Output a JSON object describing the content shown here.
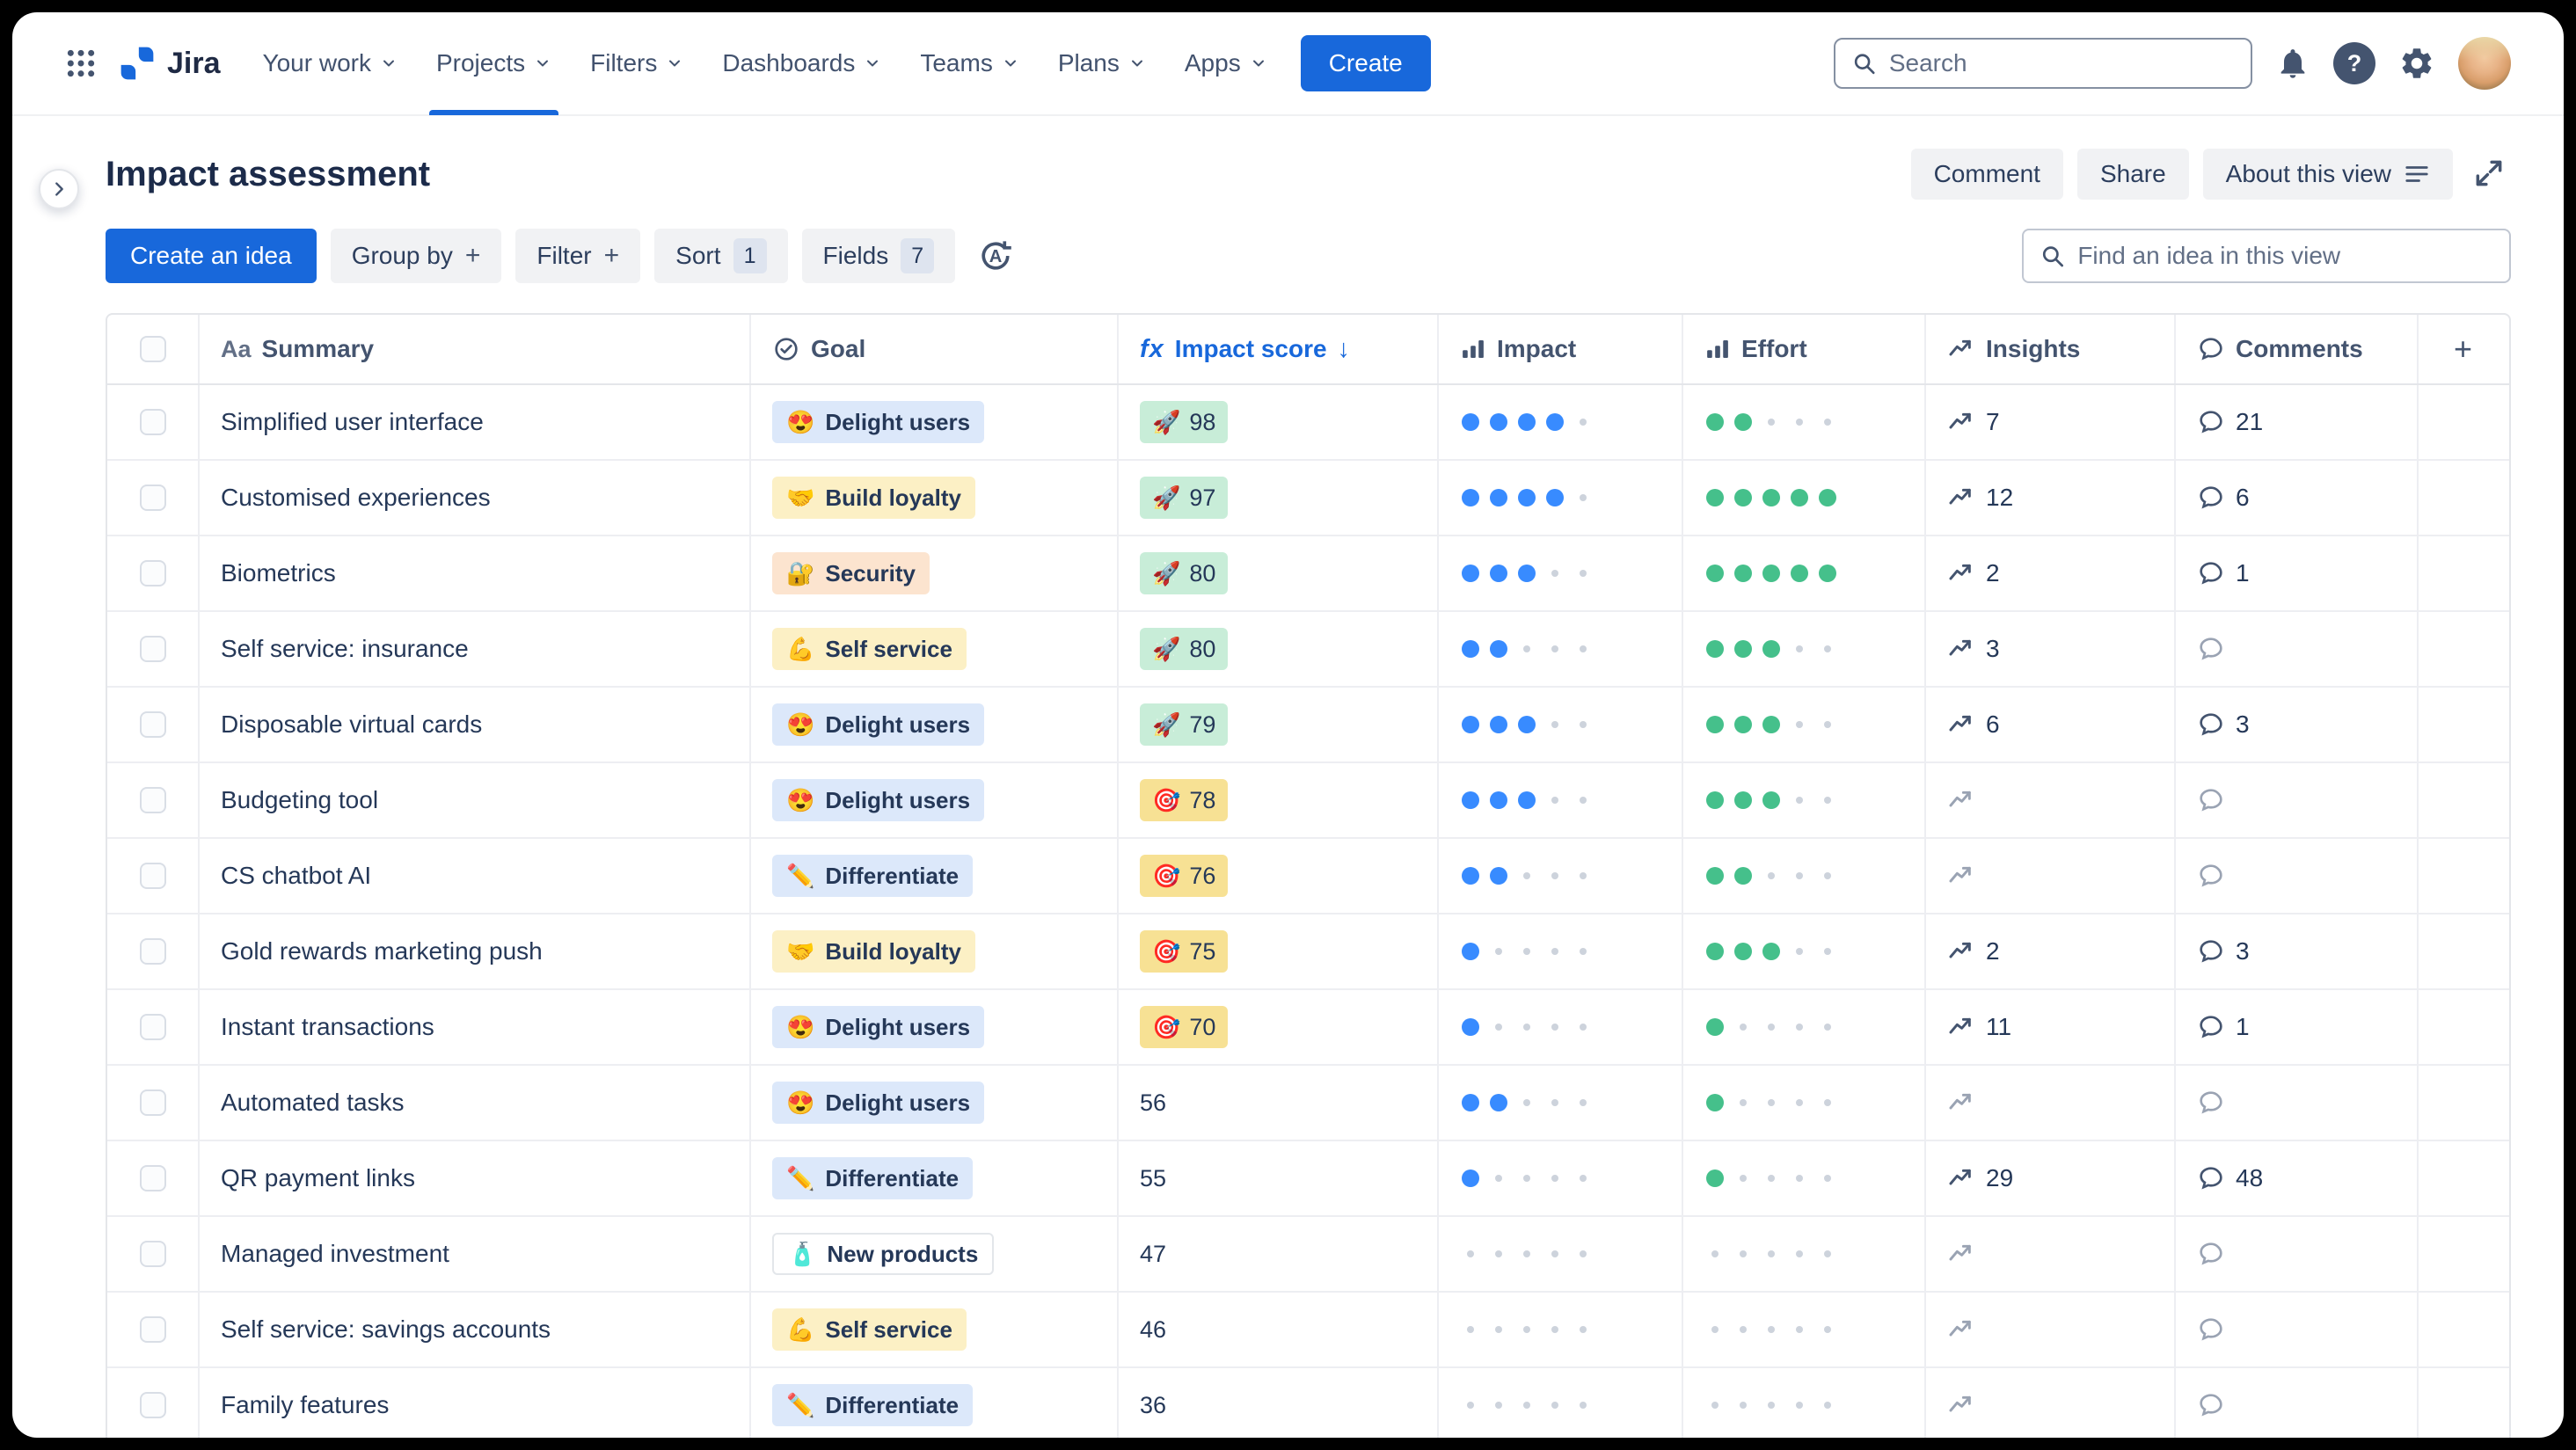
{
  "nav": {
    "logo_text": "Jira",
    "items": [
      {
        "id": "your-work",
        "label": "Your work"
      },
      {
        "id": "projects",
        "label": "Projects",
        "active": true
      },
      {
        "id": "filters",
        "label": "Filters"
      },
      {
        "id": "dashboards",
        "label": "Dashboards"
      },
      {
        "id": "teams",
        "label": "Teams"
      },
      {
        "id": "plans",
        "label": "Plans"
      },
      {
        "id": "apps",
        "label": "Apps"
      }
    ],
    "create_label": "Create",
    "search_placeholder": "Search",
    "help_glyph": "?"
  },
  "header": {
    "title": "Impact assessment",
    "comment_label": "Comment",
    "share_label": "Share",
    "about_label": "About this view"
  },
  "toolbar": {
    "create_idea_label": "Create an idea",
    "group_by_label": "Group by",
    "filter_label": "Filter",
    "sort_label": "Sort",
    "sort_count": "1",
    "fields_label": "Fields",
    "fields_count": "7",
    "plus_glyph": "+",
    "translate_glyph": "A",
    "find_placeholder": "Find an idea in this view"
  },
  "table": {
    "columns": {
      "summary_icon": "Aa",
      "summary": "Summary",
      "goal": "Goal",
      "formula_icon": "fx",
      "impact_score": "Impact score",
      "sort_arrow": "↓",
      "impact": "Impact",
      "effort": "Effort",
      "insights": "Insights",
      "comments": "Comments",
      "add_column_glyph": "+"
    },
    "goals": {
      "delight": {
        "label": "Delight users",
        "emoji": "😍",
        "bg": "#DCE8FA"
      },
      "loyalty": {
        "label": "Build loyalty",
        "emoji": "🤝",
        "bg": "#FCF0C5"
      },
      "security": {
        "label": "Security",
        "emoji": "🔐",
        "bg": "#FCE4CF"
      },
      "self_service": {
        "label": "Self service",
        "emoji": "💪",
        "bg": "#FCF0C5"
      },
      "differentiate": {
        "label": "Differentiate",
        "emoji": "✏️",
        "bg": "#DCE8FA"
      },
      "new_products": {
        "label": "New products",
        "emoji": "🧴",
        "bg": "#FFFFFF",
        "border": "#E3E6EA"
      }
    },
    "score_badges": {
      "rocket": {
        "emoji": "🚀",
        "bg": "#C8EDD8"
      },
      "dart": {
        "emoji": "🎯",
        "bg": "#F7E194"
      }
    },
    "rows": [
      {
        "summary": "Simplified user interface",
        "goal": "delight",
        "score": "98",
        "badge": "rocket",
        "impact": 4,
        "effort": 2,
        "insights": "7",
        "comments": "21"
      },
      {
        "summary": "Customised experiences",
        "goal": "loyalty",
        "score": "97",
        "badge": "rocket",
        "impact": 4,
        "effort": 5,
        "insights": "12",
        "comments": "6"
      },
      {
        "summary": "Biometrics",
        "goal": "security",
        "score": "80",
        "badge": "rocket",
        "impact": 3,
        "effort": 5,
        "insights": "2",
        "comments": "1"
      },
      {
        "summary": "Self service: insurance",
        "goal": "self_service",
        "score": "80",
        "badge": "rocket",
        "impact": 2,
        "effort": 3,
        "insights": "3",
        "comments": null
      },
      {
        "summary": "Disposable virtual cards",
        "goal": "delight",
        "score": "79",
        "badge": "rocket",
        "impact": 3,
        "effort": 3,
        "insights": "6",
        "comments": "3"
      },
      {
        "summary": "Budgeting tool",
        "goal": "delight",
        "score": "78",
        "badge": "dart",
        "impact": 3,
        "effort": 3,
        "insights": null,
        "comments": null
      },
      {
        "summary": "CS chatbot AI",
        "goal": "differentiate",
        "score": "76",
        "badge": "dart",
        "impact": 2,
        "effort": 2,
        "insights": null,
        "comments": null
      },
      {
        "summary": "Gold rewards marketing push",
        "goal": "loyalty",
        "score": "75",
        "badge": "dart",
        "impact": 1,
        "effort": 3,
        "insights": "2",
        "comments": "3"
      },
      {
        "summary": "Instant transactions",
        "goal": "delight",
        "score": "70",
        "badge": "dart",
        "impact": 1,
        "effort": 1,
        "insights": "11",
        "comments": "1"
      },
      {
        "summary": "Automated tasks",
        "goal": "delight",
        "score": "56",
        "badge": null,
        "impact": 2,
        "effort": 1,
        "insights": null,
        "comments": null
      },
      {
        "summary": "QR payment links",
        "goal": "differentiate",
        "score": "55",
        "badge": null,
        "impact": 1,
        "effort": 1,
        "insights": "29",
        "comments": "48"
      },
      {
        "summary": "Managed investment",
        "goal": "new_products",
        "score": "47",
        "badge": null,
        "impact": 0,
        "effort": 0,
        "insights": null,
        "comments": null
      },
      {
        "summary": "Self service: savings accounts",
        "goal": "self_service",
        "score": "46",
        "badge": null,
        "impact": 0,
        "effort": 0,
        "insights": null,
        "comments": null
      },
      {
        "summary": "Family features",
        "goal": "differentiate",
        "score": "36",
        "badge": null,
        "impact": 0,
        "effort": 0,
        "insights": null,
        "comments": null
      }
    ]
  },
  "colors": {
    "brand_blue": "#1868DB",
    "impact_dot": "#388BFF",
    "effort_dot": "#45C08B",
    "empty_dot": "#CDD3DC"
  }
}
